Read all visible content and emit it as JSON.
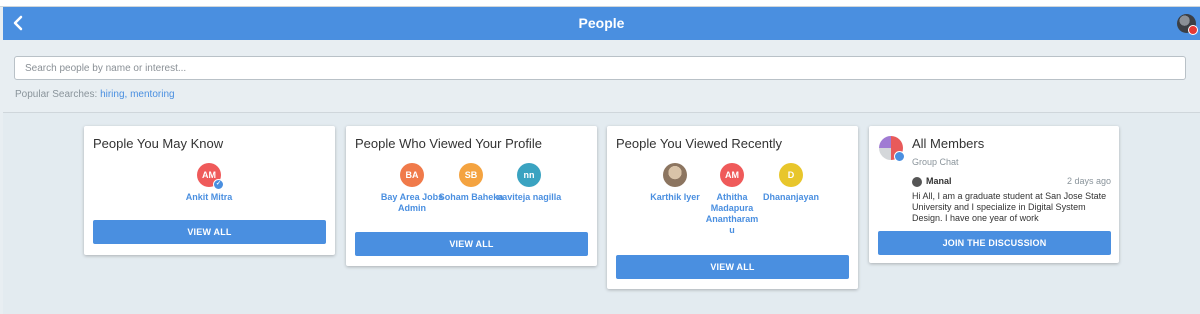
{
  "header": {
    "title": "People"
  },
  "search": {
    "placeholder": "Search people by name or interest...",
    "popular_label": "Popular Searches: ",
    "popular_terms": [
      "hiring,",
      "mentoring"
    ]
  },
  "cards": {
    "may_know": {
      "title": "People You May Know",
      "people": [
        {
          "initials": "AM",
          "name": "Ankit Mitra",
          "color": "#ef5a5a"
        }
      ],
      "button": "VIEW ALL"
    },
    "viewed_profile": {
      "title": "People Who Viewed Your Profile",
      "people": [
        {
          "initials": "BA",
          "name": "Bay Area Jobs Admin",
          "color": "#f07a4a"
        },
        {
          "initials": "SB",
          "name": "Soham Baheka",
          "color": "#f4a340"
        },
        {
          "initials": "nn",
          "name": "naviteja nagilla",
          "color": "#3aa3c1"
        }
      ],
      "button": "VIEW ALL"
    },
    "viewed_recently": {
      "title": "People You Viewed Recently",
      "people": [
        {
          "initials": "",
          "name": "Karthik Iyer",
          "color": "#b8a38c"
        },
        {
          "initials": "AM",
          "name": "Athitha Madapura Anantharam u",
          "color": "#ef5a5a"
        },
        {
          "initials": "D",
          "name": "Dhananjayan",
          "color": "#e8c62b"
        }
      ],
      "button": "VIEW ALL"
    },
    "all_members": {
      "title": "All Members",
      "subtitle": "Group Chat",
      "author": "Manal",
      "time": "2 days ago",
      "message": "Hi All, I am a graduate student at San Jose State University and I specialize in Digital System Design. I have one year of work",
      "button": "JOIN THE DISCUSSION"
    }
  },
  "colors": {
    "accent": "#4a8fe0",
    "background": "#e8eef2"
  }
}
